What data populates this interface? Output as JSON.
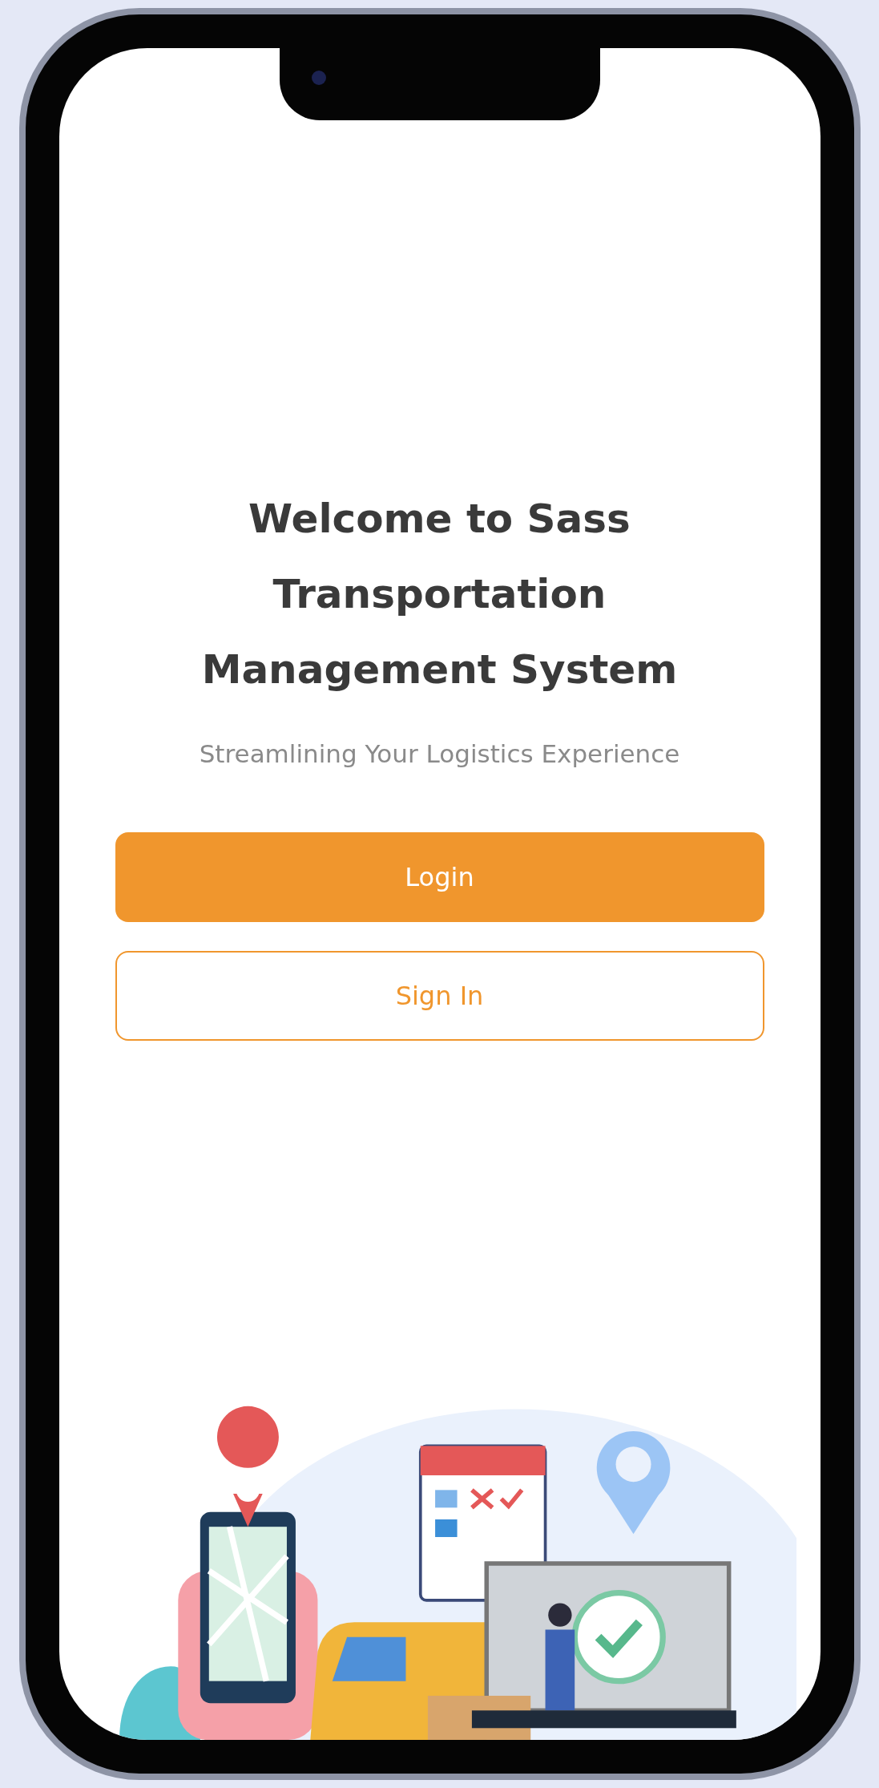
{
  "title": "Welcome to Sass Transportation Management System",
  "subtitle": "Streamlining Your Logistics Experience",
  "buttons": [
    {
      "label": "Login",
      "kind": "primary"
    },
    {
      "label": "Sign In",
      "kind": "outline"
    }
  ]
}
